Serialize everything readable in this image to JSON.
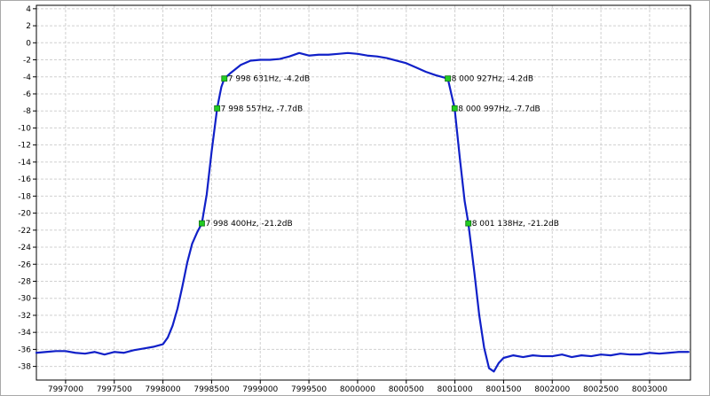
{
  "chart_data": {
    "type": "line",
    "title": "",
    "xlabel": "",
    "ylabel": "",
    "xlim": [
      7996700,
      8003420
    ],
    "ylim": [
      -39.6,
      4.4
    ],
    "x_ticks": [
      7997000,
      7997500,
      7998000,
      7998500,
      7999000,
      7999500,
      8000000,
      8000500,
      8001000,
      8001500,
      8002000,
      8002500,
      8003000
    ],
    "y_ticks": [
      4,
      2,
      0,
      -2,
      -4,
      -6,
      -8,
      -10,
      -12,
      -14,
      -16,
      -18,
      -20,
      -22,
      -24,
      -26,
      -28,
      -30,
      -32,
      -34,
      -36,
      -38
    ],
    "grid": true,
    "legend": "none",
    "colors": {
      "line": "#1020c8",
      "marker": "#22cc22",
      "marker_edge": "#107010",
      "grid": "#d0d0d0"
    },
    "series": [
      {
        "x": [
          7996700,
          7996800,
          7996900,
          7997000,
          7997100,
          7997200,
          7997300,
          7997400,
          7997500,
          7997600,
          7997700,
          7997800,
          7997900,
          7998000,
          7998050,
          7998100,
          7998150,
          7998200,
          7998250,
          7998300,
          7998350,
          7998400,
          7998450,
          7998500,
          7998557,
          7998600,
          7998631,
          7998700,
          7998800,
          7998900,
          7999000,
          7999100,
          7999200,
          7999300,
          7999400,
          7999500,
          7999600,
          7999700,
          7999800,
          7999900,
          8000000,
          8000100,
          8000200,
          8000300,
          8000400,
          8000500,
          8000600,
          8000700,
          8000800,
          8000927,
          8000997,
          8001050,
          8001100,
          8001138,
          8001200,
          8001250,
          8001300,
          8001350,
          8001400,
          8001450,
          8001500,
          8001600,
          8001700,
          8001800,
          8001900,
          8002000,
          8002100,
          8002200,
          8002300,
          8002400,
          8002500,
          8002600,
          8002700,
          8002800,
          8002900,
          8003000,
          8003100,
          8003200,
          8003300,
          8003400
        ],
        "y": [
          -36.4,
          -36.3,
          -36.2,
          -36.2,
          -36.4,
          -36.5,
          -36.3,
          -36.6,
          -36.3,
          -36.4,
          -36.1,
          -35.9,
          -35.7,
          -35.4,
          -34.6,
          -33.2,
          -31.2,
          -28.6,
          -25.8,
          -23.6,
          -22.3,
          -21.2,
          -17.8,
          -12.8,
          -7.7,
          -5.2,
          -4.2,
          -3.5,
          -2.6,
          -2.1,
          -2.0,
          -2.0,
          -1.9,
          -1.6,
          -1.2,
          -1.5,
          -1.4,
          -1.4,
          -1.3,
          -1.2,
          -1.3,
          -1.5,
          -1.6,
          -1.8,
          -2.1,
          -2.4,
          -2.9,
          -3.4,
          -3.8,
          -4.2,
          -7.7,
          -13.5,
          -18.6,
          -21.2,
          -27.0,
          -32.0,
          -35.8,
          -38.2,
          -38.6,
          -37.6,
          -37.0,
          -36.7,
          -36.9,
          -36.7,
          -36.8,
          -36.8,
          -36.6,
          -36.9,
          -36.7,
          -36.8,
          -36.6,
          -36.7,
          -36.5,
          -36.6,
          -36.6,
          -36.4,
          -36.5,
          -36.4,
          -36.3,
          -36.3
        ]
      }
    ],
    "annotations": [
      {
        "x": 7998631,
        "y": -4.2,
        "label": "7 998 631Hz, -4.2dB"
      },
      {
        "x": 7998557,
        "y": -7.7,
        "label": "7 998 557Hz, -7.7dB"
      },
      {
        "x": 7998400,
        "y": -21.2,
        "label": "7 998 400Hz, -21.2dB"
      },
      {
        "x": 8000927,
        "y": -4.2,
        "label": "8 000 927Hz, -4.2dB"
      },
      {
        "x": 8000997,
        "y": -7.7,
        "label": "8 000 997Hz, -7.7dB"
      },
      {
        "x": 8001138,
        "y": -21.2,
        "label": "8 001 138Hz, -21.2dB"
      }
    ]
  }
}
